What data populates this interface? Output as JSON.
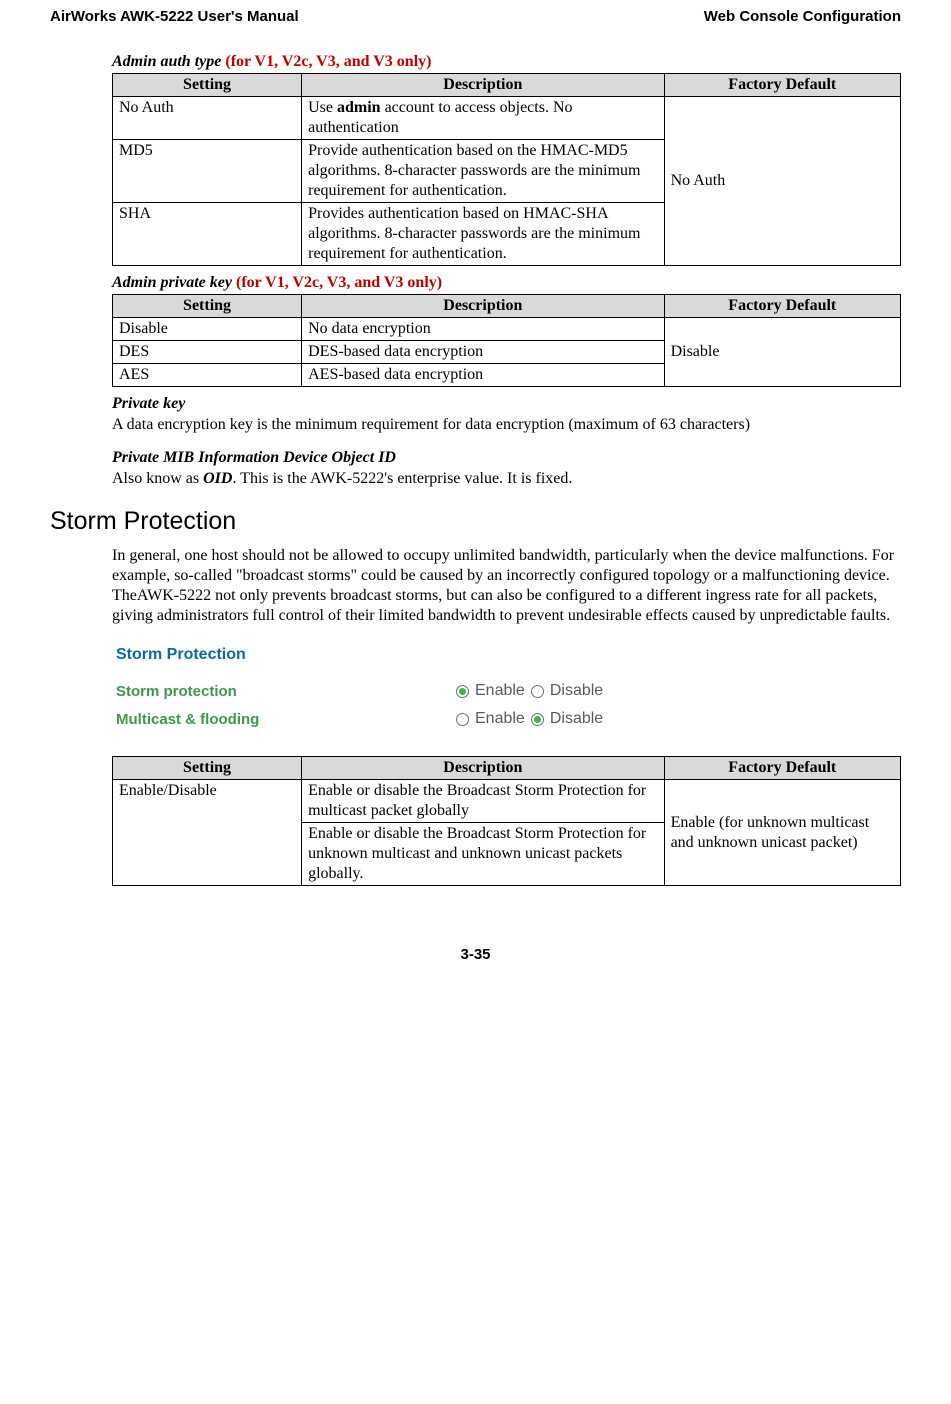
{
  "running_head": {
    "left": "AirWorks AWK-5222 User's Manual",
    "right": "Web Console Configuration"
  },
  "admin_auth": {
    "title": "Admin auth type",
    "v_note": "(for V1, V2c, V3, and V3 only)",
    "headers": {
      "c1": "Setting",
      "c2": "Description",
      "c3": "Factory Default"
    },
    "rows": [
      {
        "setting": "No Auth",
        "desc_pre": "Use ",
        "desc_bold": "admin",
        "desc_post": " account to access objects. No authentication"
      },
      {
        "setting": "MD5",
        "desc": "Provide authentication based on the HMAC-MD5 algorithms. 8-character passwords are the minimum requirement for authentication."
      },
      {
        "setting": "SHA",
        "desc": "Provides authentication based on HMAC-SHA algorithms. 8-character passwords are the minimum requirement for authentication."
      }
    ],
    "factory_default": "No Auth"
  },
  "admin_priv": {
    "title": "Admin private key",
    "v_note": "(for V1, V2c, V3, and V3 only)",
    "headers": {
      "c1": "Setting",
      "c2": "Description",
      "c3": "Factory Default"
    },
    "rows": [
      {
        "setting": "Disable",
        "desc": "No data encryption"
      },
      {
        "setting": "DES",
        "desc": "DES-based data encryption"
      },
      {
        "setting": "AES",
        "desc": "AES-based data encryption"
      }
    ],
    "factory_default": "Disable"
  },
  "private_key": {
    "title": "Private key",
    "body": "A data encryption key is the minimum requirement for data encryption (maximum of 63 characters)"
  },
  "mib": {
    "title": "Private MIB Information Device Object ID",
    "body_pre": "Also know as ",
    "body_bold": "OID",
    "body_post": ". This is the AWK-5222's enterprise value. It is fixed."
  },
  "storm": {
    "heading": "Storm Protection",
    "intro": "In general, one host should not be allowed to occupy unlimited bandwidth, particularly when the device malfunctions. For example, so-called \"broadcast storms\" could be caused by an incorrectly configured topology or a malfunctioning device. TheAWK-5222 not only prevents broadcast storms, but can also be configured to a different ingress rate for all packets, giving administrators full control of their limited bandwidth to prevent undesirable effects caused by unpredictable faults.",
    "panel": {
      "title": "Storm Protection",
      "rows": [
        {
          "label": "Storm protection",
          "opt1": "Enable",
          "opt2": "Disable",
          "checked": 1
        },
        {
          "label": "Multicast & flooding",
          "opt1": "Enable",
          "opt2": "Disable",
          "checked": 2
        }
      ]
    },
    "table": {
      "headers": {
        "c1": "Setting",
        "c2": "Description",
        "c3": "Factory Default"
      },
      "setting": "Enable/Disable",
      "desc1": "Enable or disable the Broadcast Storm Protection for multicast packet globally",
      "desc2": "Enable or disable the Broadcast Storm Protection for unknown multicast and unknown unicast packets globally.",
      "factory_default": "Enable (for unknown multicast and unknown unicast packet)"
    }
  },
  "page_number": "3-35"
}
